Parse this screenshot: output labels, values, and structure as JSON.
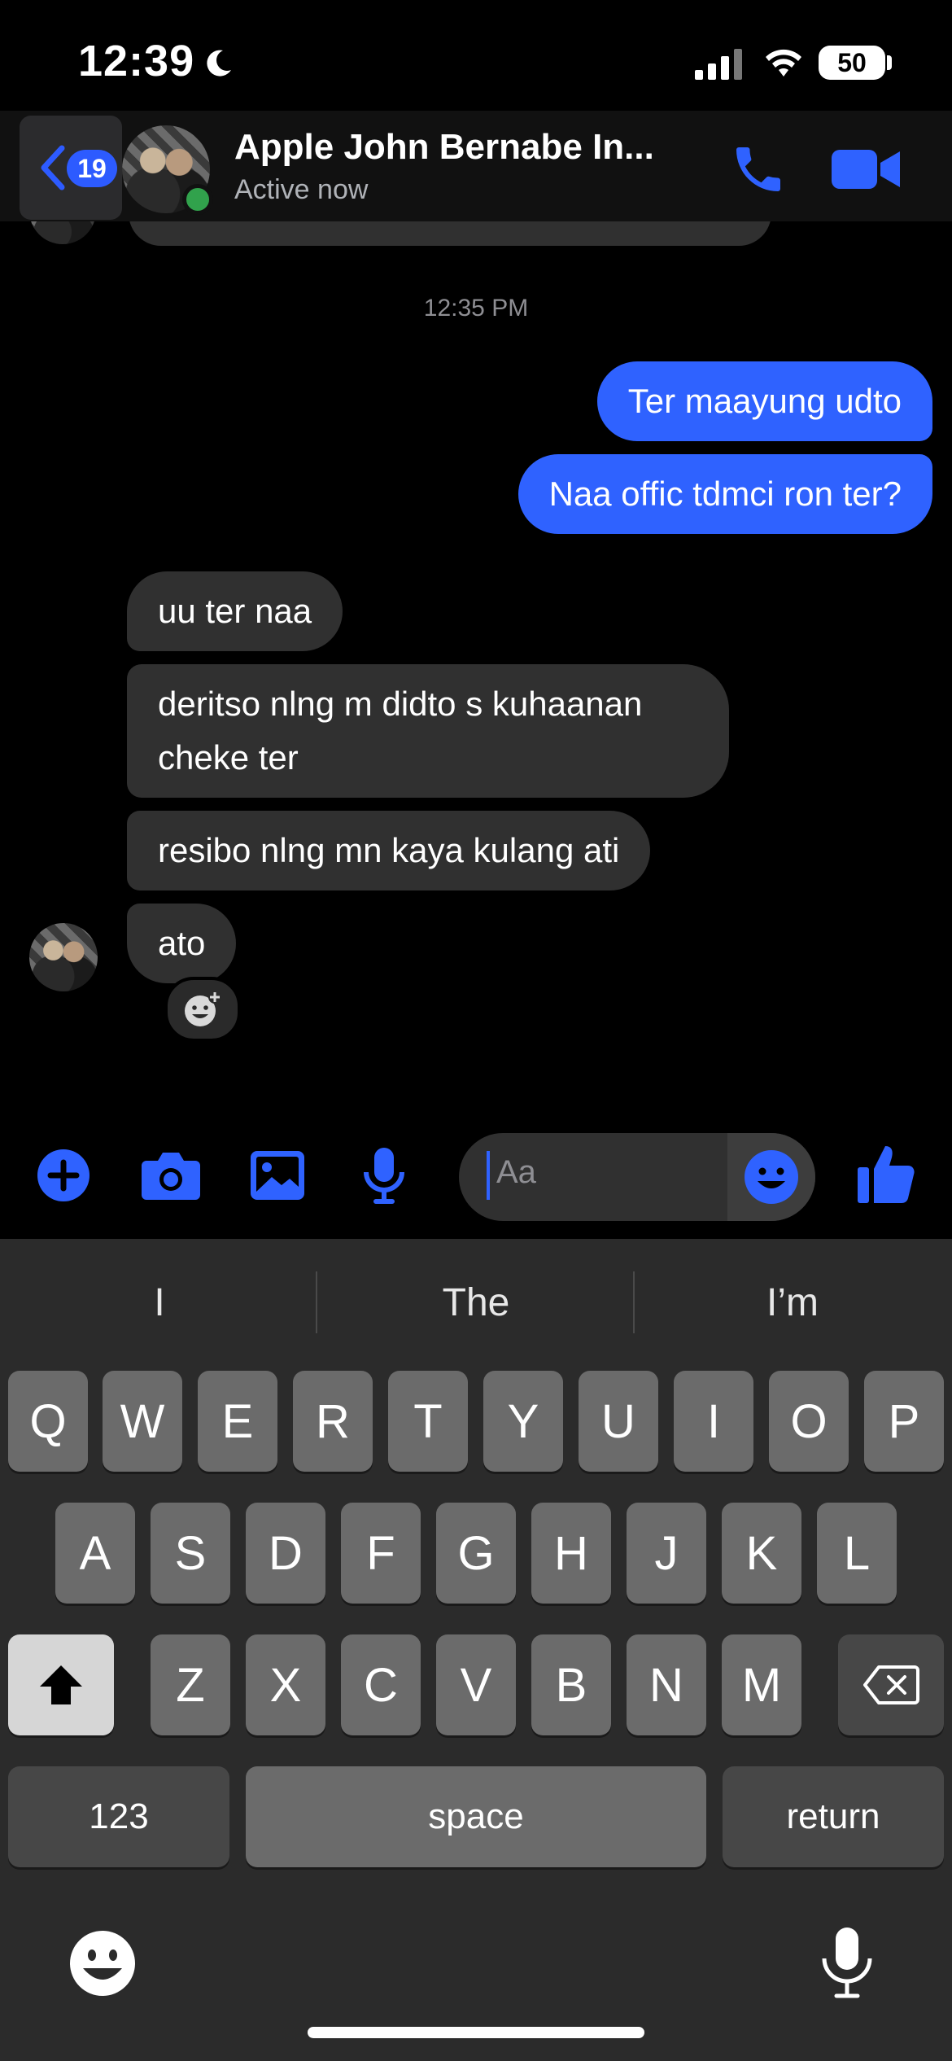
{
  "status_bar": {
    "time": "12:39",
    "battery": "50"
  },
  "header": {
    "unread_count": "19",
    "contact_name": "Apple John Bernabe In...",
    "contact_status": "Active now"
  },
  "chat": {
    "timestamp": "12:35 PM",
    "messages": [
      {
        "direction": "out",
        "text": "Ter maayung udto"
      },
      {
        "direction": "out",
        "text": "Naa offic tdmci ron ter?"
      },
      {
        "direction": "in",
        "text": "uu ter naa"
      },
      {
        "direction": "in",
        "text": "deritso nlng m didto s kuhaanan cheke ter"
      },
      {
        "direction": "in",
        "text": "resibo nlng mn kaya kulang ati"
      },
      {
        "direction": "in",
        "text": "ato"
      }
    ]
  },
  "composer": {
    "placeholder": "Aa"
  },
  "keyboard": {
    "suggestions": [
      "I",
      "The",
      "I’m"
    ],
    "row1": [
      "Q",
      "W",
      "E",
      "R",
      "T",
      "Y",
      "U",
      "I",
      "O",
      "P"
    ],
    "row2": [
      "A",
      "S",
      "D",
      "F",
      "G",
      "H",
      "J",
      "K",
      "L"
    ],
    "row3": [
      "Z",
      "X",
      "C",
      "V",
      "B",
      "N",
      "M"
    ],
    "numbers_label": "123",
    "space_label": "space",
    "return_label": "return"
  },
  "colors": {
    "accent": "#2f62ff",
    "incoming_bubble": "#303030",
    "active_dot": "#31a24c"
  }
}
